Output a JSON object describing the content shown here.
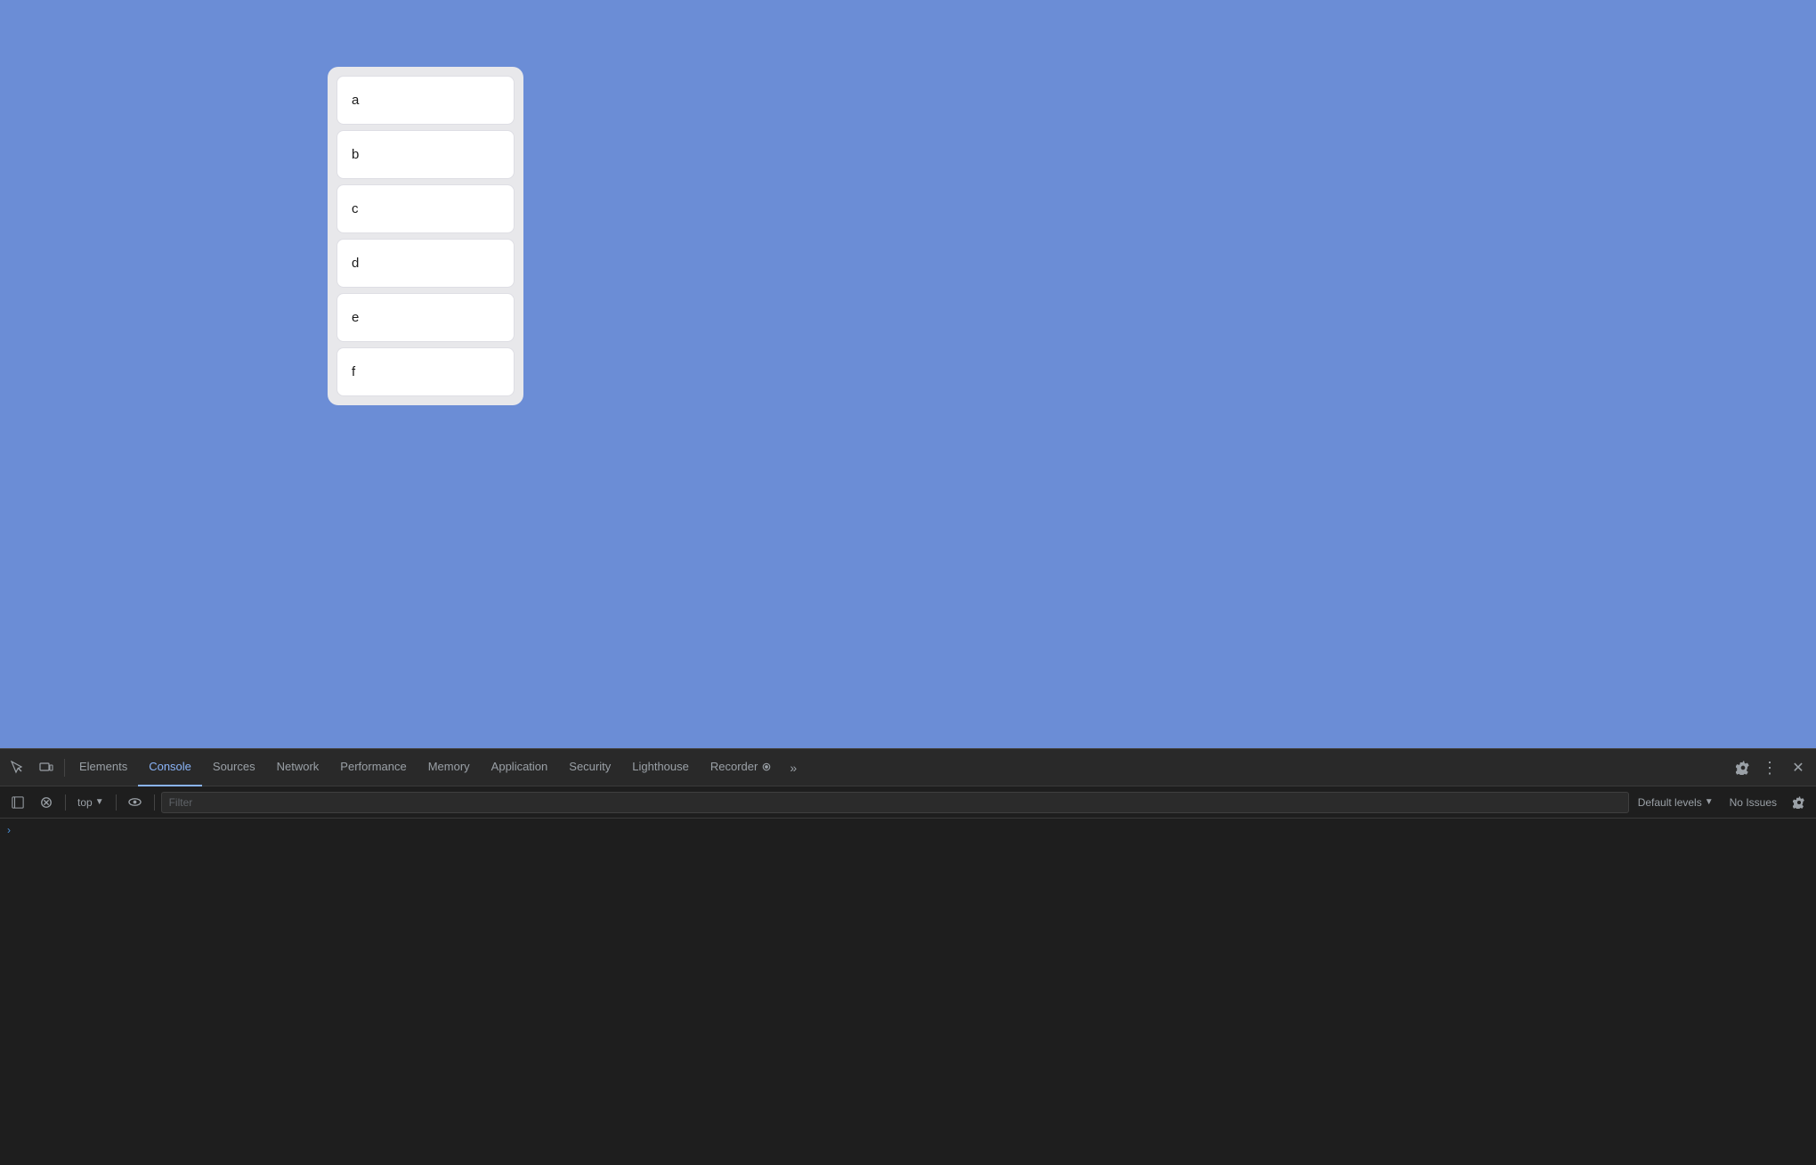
{
  "viewport": {
    "background_color": "#6b8dd6"
  },
  "card": {
    "items": [
      {
        "label": "a",
        "id": "item-a"
      },
      {
        "label": "b",
        "id": "item-b"
      },
      {
        "label": "c",
        "id": "item-c"
      },
      {
        "label": "d",
        "id": "item-d"
      },
      {
        "label": "e",
        "id": "item-e"
      },
      {
        "label": "f",
        "id": "item-f"
      }
    ]
  },
  "devtools": {
    "tabs": [
      {
        "label": "Elements",
        "active": false
      },
      {
        "label": "Console",
        "active": true
      },
      {
        "label": "Sources",
        "active": false
      },
      {
        "label": "Network",
        "active": false
      },
      {
        "label": "Performance",
        "active": false
      },
      {
        "label": "Memory",
        "active": false
      },
      {
        "label": "Application",
        "active": false
      },
      {
        "label": "Security",
        "active": false
      },
      {
        "label": "Lighthouse",
        "active": false
      },
      {
        "label": "Recorder",
        "active": false
      }
    ],
    "console_toolbar": {
      "context": "top",
      "filter_placeholder": "Filter",
      "default_levels_label": "Default levels",
      "no_issues_label": "No Issues"
    }
  }
}
